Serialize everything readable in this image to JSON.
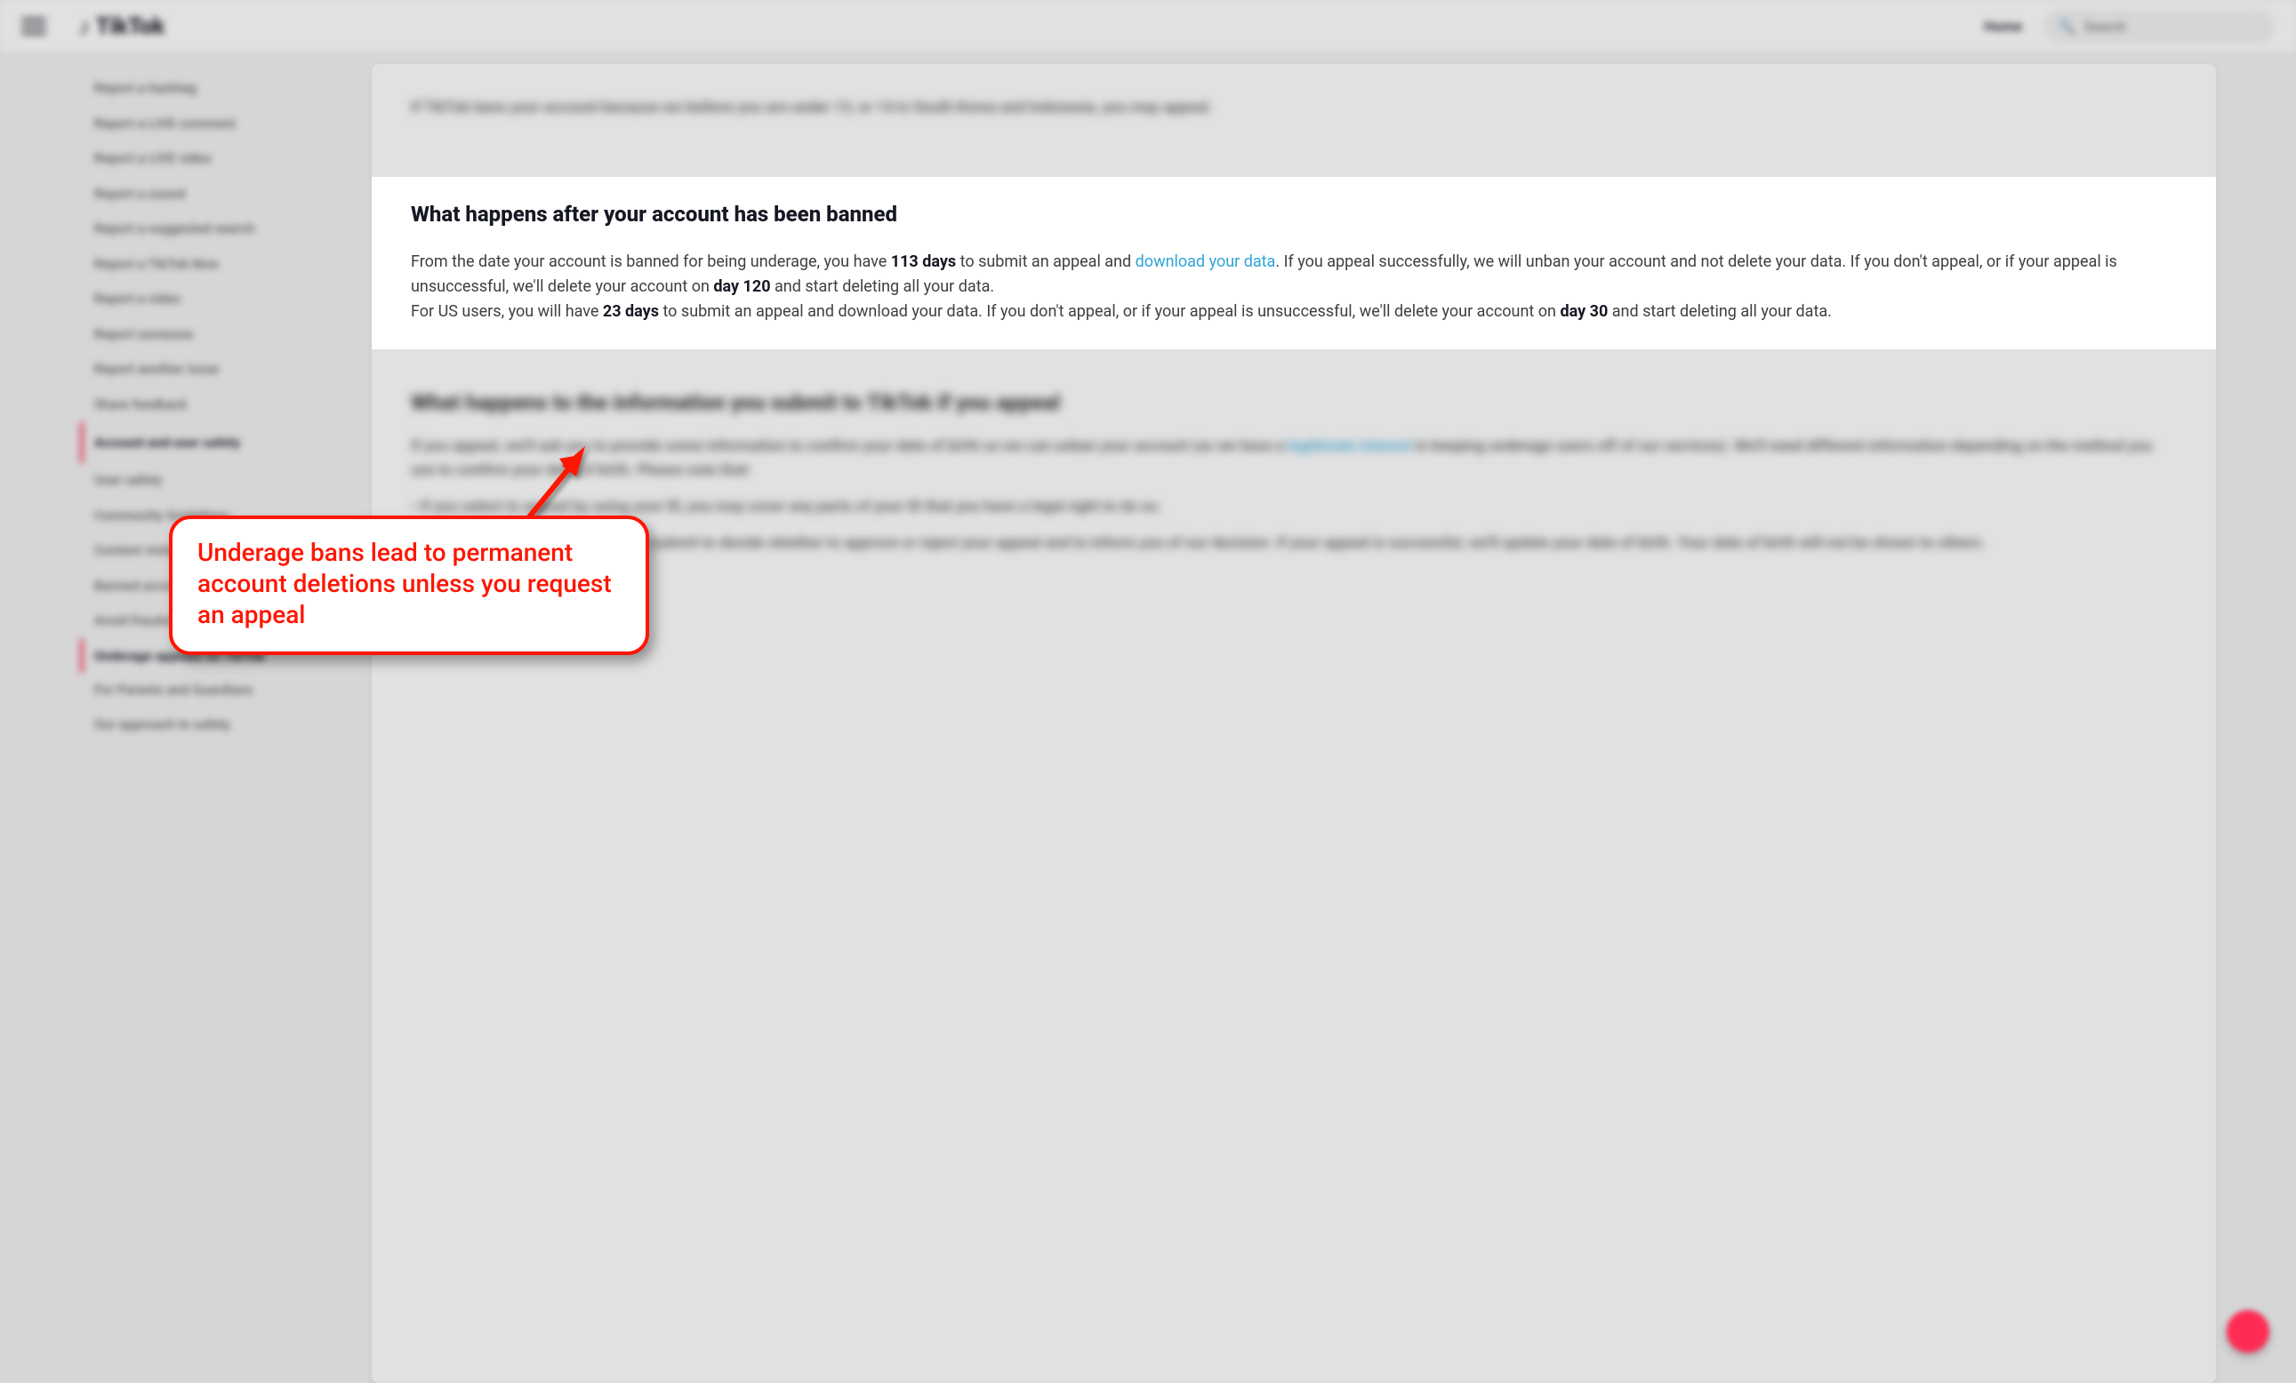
{
  "header": {
    "brand_glyph": "♪",
    "brand_name": "TikTok",
    "home_label": "Home",
    "search_placeholder": "Search"
  },
  "sidebar": {
    "items_before": [
      "Report a hashtag",
      "Report a LIVE comment",
      "Report a LIVE video",
      "Report a sound",
      "Report a suggested search",
      "Report a TikTok Now",
      "Report a video",
      "Report someone",
      "Report another issue",
      "Share feedback"
    ],
    "section1": "Account and user safety",
    "sub1": [
      "User safety",
      "Community Guidelines",
      "Content violations",
      "Banned accounts",
      "Avoid fraudulent messages on TikTok"
    ],
    "active": "Underage appeals on TikTok",
    "sub2": [
      "For Parents and Guardians",
      "Our approach to safety"
    ]
  },
  "article": {
    "intro": "If TikTok bans your account because we believe you are under 13, or 14 in South Korea and Indonesia, you may appeal.",
    "focus": {
      "heading": "What happens after your account has been banned",
      "p1a": "From the date your account is banned for being underage, you have ",
      "d113": "113 days",
      "p1b": " to submit an appeal and ",
      "link_dl": "download your data",
      "p1c": ". If you appeal successfully, we will unban your account and not delete your data. If you don't appeal, or if your appeal is unsuccessful, we'll delete your account on ",
      "d120": "day 120",
      "p1d": " and start deleting all your data.",
      "p2a": "For US users, you will have ",
      "d23": "23 days",
      "p2b": " to submit an appeal and download your data. If you don't appeal, or if your appeal is unsuccessful, we'll delete your account on ",
      "d30": "day 30",
      "p2c": " and start deleting all your data."
    },
    "after": {
      "heading": "What happens to the information you submit to TikTok if you appeal",
      "p1a": "If you appeal, we'll ask you to provide some information to confirm your date of birth so we can unban your account (as we have a ",
      "link": "legitimate interest",
      "p1b": " in keeping underage users off of our services). We'll need different information depending on the method you use to confirm your date of birth. Please note that:",
      "b1": "•  If you select to appeal by using your ID, you may cover any parts of your ID that you have a legal right to do so.",
      "b2": "•  We'll only use the information you submit to decide whether to approve or reject your appeal and to inform you of our decision. If your appeal is successful, we'll update your date of birth. Your date of birth will not be shown to others."
    }
  },
  "annotation": {
    "callout": "Underage bans lead to permanent account deletions unless you request an appeal"
  }
}
